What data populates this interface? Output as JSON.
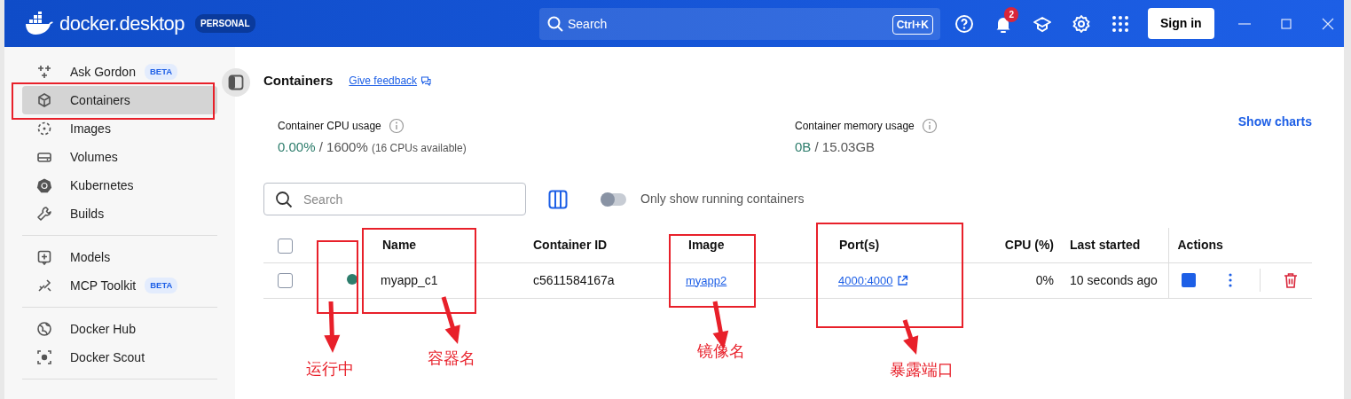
{
  "header": {
    "logo_text": "docker.desktop",
    "plan_badge": "PERSONAL",
    "search": {
      "placeholder": "Search",
      "shortcut": "Ctrl+K"
    },
    "notification_count": "2",
    "sign_in": "Sign in"
  },
  "sidebar": {
    "groups": [
      [
        {
          "label": "Ask Gordon",
          "badge": "BETA",
          "selected": false
        },
        {
          "label": "Containers",
          "selected": true
        },
        {
          "label": "Images",
          "selected": false
        },
        {
          "label": "Volumes",
          "selected": false
        },
        {
          "label": "Kubernetes",
          "selected": false
        },
        {
          "label": "Builds",
          "selected": false
        }
      ],
      [
        {
          "label": "Models",
          "selected": false
        },
        {
          "label": "MCP Toolkit",
          "badge": "BETA",
          "selected": false
        }
      ],
      [
        {
          "label": "Docker Hub",
          "selected": false
        },
        {
          "label": "Docker Scout",
          "selected": false
        }
      ]
    ]
  },
  "page": {
    "title": "Containers",
    "feedback_link": "Give feedback",
    "show_charts": "Show charts"
  },
  "stats": [
    {
      "label": "Container CPU usage",
      "used": "0.00%",
      "total": "/ 1600%",
      "note": "(16 CPUs available)"
    },
    {
      "label": "Container memory usage",
      "used": "0B",
      "total": "/ 15.03GB"
    }
  ],
  "toolbar": {
    "search": {
      "placeholder": "Search"
    },
    "running_only": {
      "label": "Only show running containers",
      "on": false
    }
  },
  "table": {
    "select_all": {
      "checked": false
    },
    "columns": [
      "Name",
      "Container ID",
      "Image",
      "Port(s)",
      "CPU (%)",
      "Last started",
      "Actions"
    ],
    "rows": [
      {
        "checked": false,
        "running": true,
        "name": "myapp_c1",
        "container_id": "c5611584167a",
        "image": "myapp2",
        "ports": "4000:4000",
        "cpu": "0%",
        "last_started": "10 seconds ago"
      }
    ]
  },
  "annotations": [
    {
      "label": "运行中"
    },
    {
      "label": "容器名"
    },
    {
      "label": "镜像名"
    },
    {
      "label": "暴露端口"
    }
  ]
}
